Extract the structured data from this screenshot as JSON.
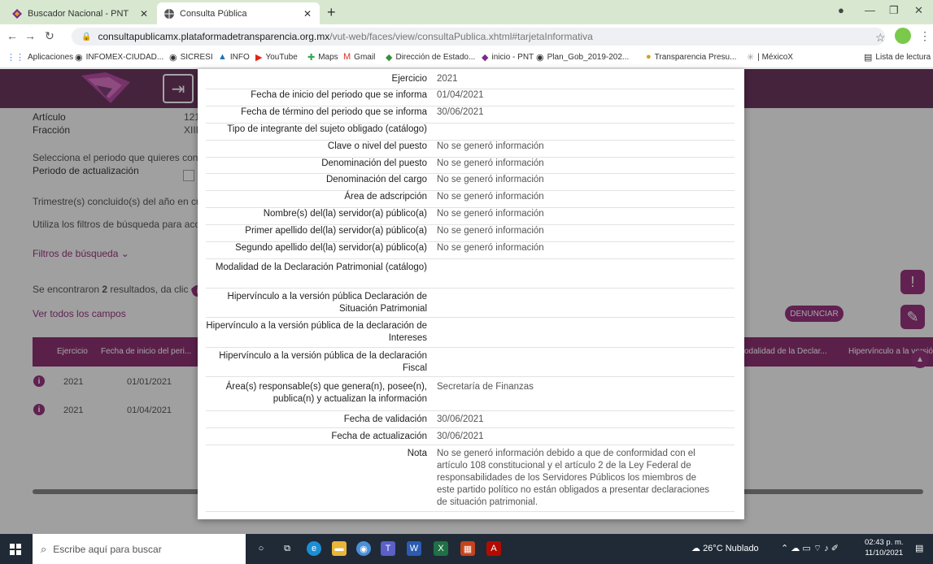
{
  "browser": {
    "tabs": [
      {
        "title": "Buscador Nacional - PNT",
        "active": false
      },
      {
        "title": "Consulta Pública",
        "active": true
      }
    ],
    "url_domain": "consultapublicamx.plataformadetransparencia.org.mx",
    "url_path": "/vut-web/faces/view/consultaPublica.xhtml#tarjetaInformativa",
    "bookmarks": [
      "Aplicaciones",
      "INFOMEX-CIUDAD...",
      "SICRESI",
      "INFO",
      "YouTube",
      "Maps",
      "Gmail",
      "Dirección de Estado...",
      "inicio - PNT",
      "Plan_Gob_2019-202...",
      "Transparencia Presu...",
      "| MéxicoX",
      "Lista de lectura"
    ]
  },
  "page": {
    "articulo_label": "Artículo",
    "articulo_value": "121",
    "fraccion_label": "Fracción",
    "fraccion_value": "XIII",
    "periodo_prompt": "Selecciona el periodo que quieres consult",
    "periodo_label": "Periodo de actualización",
    "trimestre_text": "Trimestre(s) concluido(s) del año en curso",
    "filtros_hint": "Utiliza los filtros de búsqueda para acotar",
    "filtros_link": "Filtros de búsqueda",
    "results_prefix": "Se encontraron ",
    "results_count": "2",
    "results_suffix": " resultados, da clic en",
    "ver_todos": "Ver todos los campos",
    "denunciar": "DENUNCIAR",
    "columns": [
      "Ejercicio",
      "Fecha de inicio del peri...",
      "odalidad de la Declar...",
      "Hipervínculo a la versió"
    ],
    "rows": [
      {
        "ejercicio": "2021",
        "fecha": "01/01/2021"
      },
      {
        "ejercicio": "2021",
        "fecha": "01/04/2021"
      }
    ]
  },
  "modal": {
    "fields": [
      {
        "label": "Ejercicio",
        "value": "2021"
      },
      {
        "label": "Fecha de inicio del periodo que se informa",
        "value": "01/04/2021"
      },
      {
        "label": "Fecha de término del periodo que se informa",
        "value": "30/06/2021"
      },
      {
        "label": "Tipo de integrante del sujeto obligado (catálogo)",
        "value": ""
      },
      {
        "label": "Clave o nivel del puesto",
        "value": "No se generó información"
      },
      {
        "label": "Denominación del puesto",
        "value": "No se generó información"
      },
      {
        "label": "Denominación del cargo",
        "value": "No se generó información"
      },
      {
        "label": "Área de adscripción",
        "value": "No se generó información"
      },
      {
        "label": "Nombre(s) del(la) servidor(a) público(a)",
        "value": "No se generó información"
      },
      {
        "label": "Primer apellido del(la) servidor(a) público(a)",
        "value": "No se generó información"
      },
      {
        "label": "Segundo apellido del(la) servidor(a) público(a)",
        "value": "No se generó información"
      },
      {
        "label": "Modalidad de la Declaración Patrimonial (catálogo)",
        "value": ""
      },
      {
        "label": "Hipervínculo a la versión pública Declaración de Situación Patrimonial",
        "value": ""
      },
      {
        "label": "Hipervínculo a la versión pública de la declaración de Intereses",
        "value": ""
      },
      {
        "label": "Hipervínculo a la versión pública de la declaración Fiscal",
        "value": ""
      },
      {
        "label": "Área(s) responsable(s) que genera(n), posee(n), publica(n) y actualizan la información",
        "value": "Secretaría de Finanzas"
      },
      {
        "label": "Fecha de validación",
        "value": "30/06/2021"
      },
      {
        "label": "Fecha de actualización",
        "value": "30/06/2021"
      },
      {
        "label": "Nota",
        "value": "No se generó información debido a que de conformidad con el artículo 108 constitucional y el artículo 2 de la Ley Federal de responsabilidades de los Servidores Públicos los miembros de este partido político no están obligados a presentar declaraciones de situación patrimonial."
      }
    ]
  },
  "taskbar": {
    "search_placeholder": "Escribe aquí para buscar",
    "weather": "26°C  Nublado",
    "time": "02:43 p. m.",
    "date": "11/10/2021"
  },
  "colors": {
    "brand": "#8a1d6e",
    "header": "#5a1f4d",
    "tabbar": "#d8e8d0",
    "taskbar": "#1f2a36"
  }
}
